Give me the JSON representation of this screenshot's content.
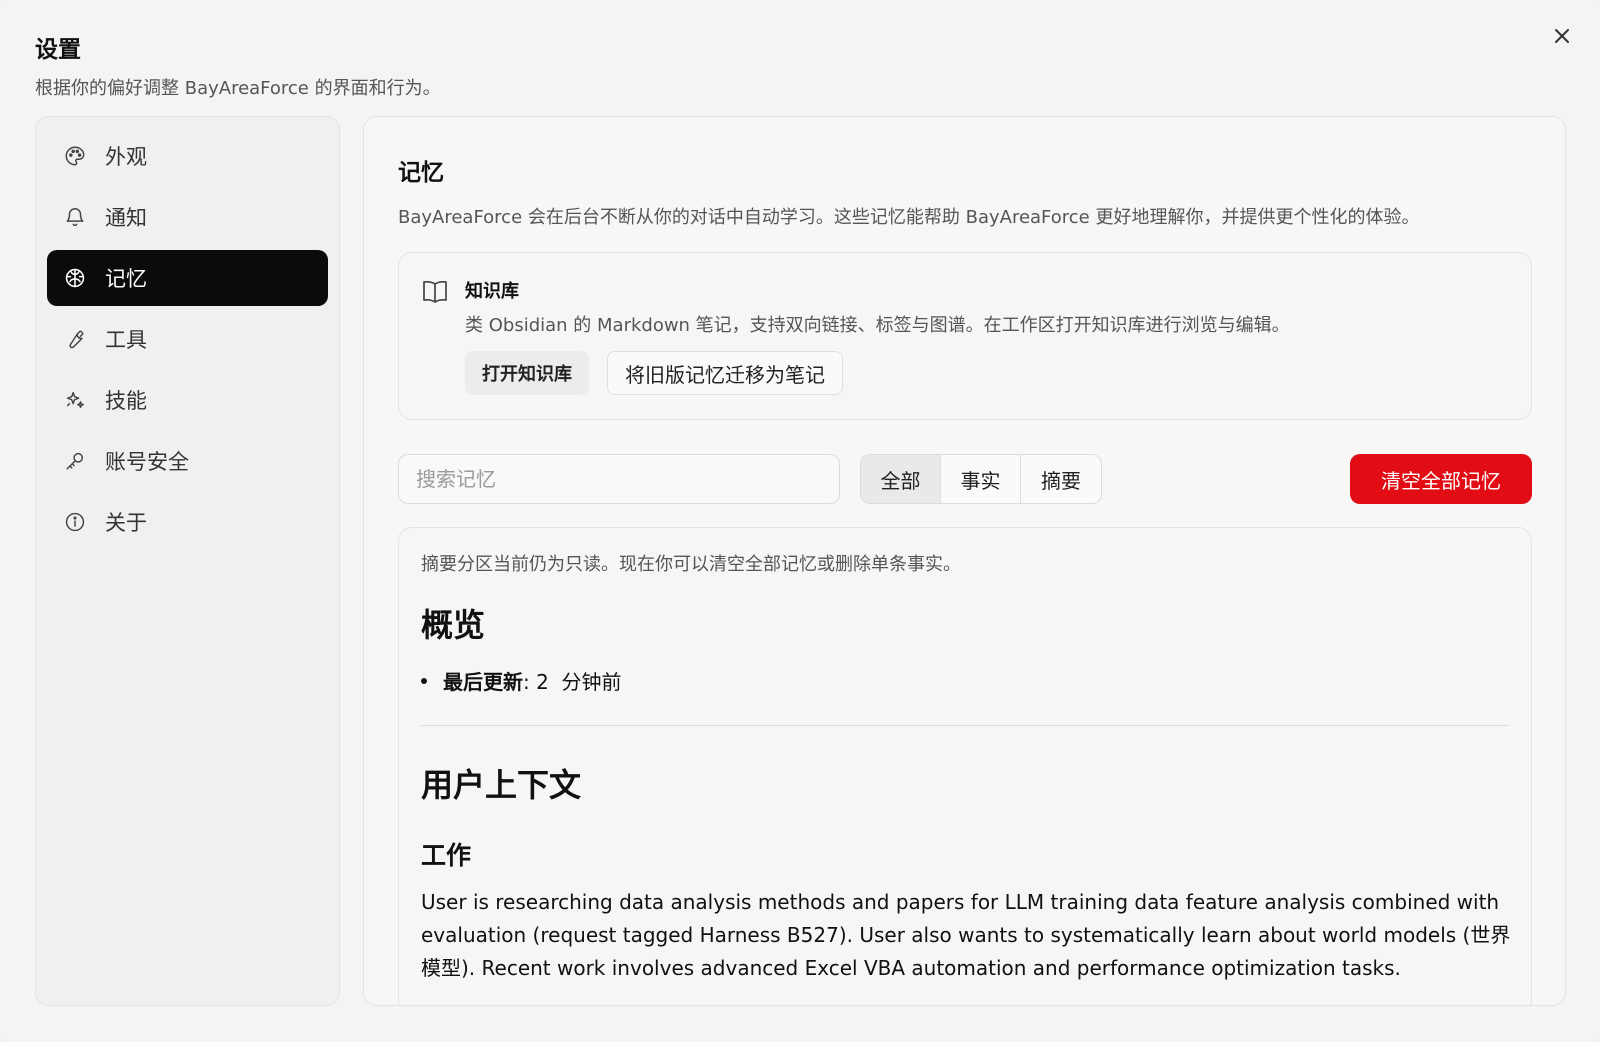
{
  "dialog": {
    "title": "设置",
    "subtitle": "根据你的偏好调整 BayAreaForce 的界面和行为。",
    "close_icon": "close-icon"
  },
  "sidebar": {
    "items": [
      {
        "label": "外观",
        "icon": "palette-icon",
        "active": false
      },
      {
        "label": "通知",
        "icon": "bell-icon",
        "active": false
      },
      {
        "label": "记忆",
        "icon": "brain-icon",
        "active": true
      },
      {
        "label": "工具",
        "icon": "wrench-icon",
        "active": false
      },
      {
        "label": "技能",
        "icon": "sparkles-icon",
        "active": false
      },
      {
        "label": "账号安全",
        "icon": "key-icon",
        "active": false
      },
      {
        "label": "关于",
        "icon": "info-icon",
        "active": false
      }
    ]
  },
  "memory": {
    "title": "记忆",
    "description": "BayAreaForce 会在后台不断从你的对话中自动学习。这些记忆能帮助 BayAreaForce 更好地理解你，并提供更个性化的体验。",
    "knowledge_base": {
      "title": "知识库",
      "description": "类 Obsidian 的 Markdown 笔记，支持双向链接、标签与图谱。在工作区打开知识库进行浏览与编辑。",
      "open_label": "打开知识库",
      "migrate_label": "将旧版记忆迁移为笔记"
    },
    "search": {
      "placeholder": "搜索记忆",
      "value": ""
    },
    "filters": [
      {
        "label": "全部",
        "active": true
      },
      {
        "label": "事实",
        "active": false
      },
      {
        "label": "摘要",
        "active": false
      }
    ],
    "clear_label": "清空全部记忆",
    "content": {
      "note": "摘要分区当前仍为只读。现在你可以清空全部记忆或删除单条事实。",
      "overview_heading": "概览",
      "last_updated_label": "最后更新",
      "last_updated_value": ": 2  分钟前",
      "context_heading": "用户上下文",
      "work_heading": "工作",
      "work_text": "User is researching data analysis methods and papers for LLM training data feature analysis combined with evaluation (request tagged Harness B527). User also wants to systematically learn about world models (世界模型). Recent work involves advanced Excel VBA automation and performance optimization tasks."
    }
  },
  "colors": {
    "active_nav_bg": "#0b0b0b",
    "danger": "#e20d14"
  }
}
